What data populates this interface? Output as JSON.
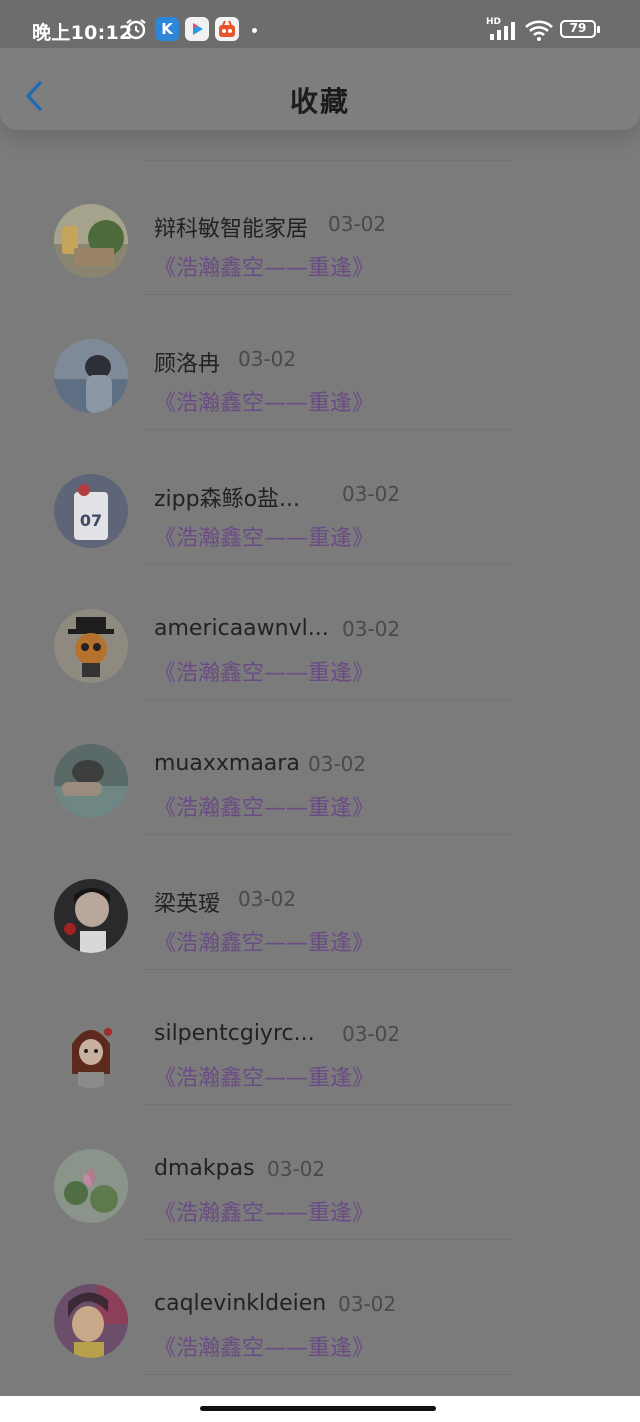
{
  "status_bar": {
    "time": "晚上10:12",
    "battery": "79",
    "network_label": "HD",
    "icons": [
      "alarm-icon",
      "kugou-app-icon",
      "video-app-icon",
      "taobao-app-icon",
      "notification-dot-icon",
      "signal-icon",
      "wifi-icon",
      "battery-icon"
    ]
  },
  "header": {
    "title": "收藏",
    "back_icon": "chevron-left-icon"
  },
  "colors": {
    "accent": "#1e6bb0",
    "work_title": "#6a4c85",
    "overlay_bg": "#7b7b7b"
  },
  "items": [
    {
      "name": "辩科敏智能家居",
      "date": "03-02",
      "work": "《浩瀚鑫空——重逢》",
      "avatar": "avatar-plant-cup"
    },
    {
      "name": "顾洛冉",
      "date": "03-02",
      "work": "《浩瀚鑫空——重逢》",
      "avatar": "avatar-person-sea"
    },
    {
      "name": "zipp森鲧o盐...",
      "date": "03-02",
      "work": "《浩瀚鑫空——重逢》",
      "avatar": "avatar-jersey"
    },
    {
      "name": "americaawnvl...",
      "date": "03-02",
      "work": "《浩瀚鑫空——重逢》",
      "avatar": "avatar-doll-hat"
    },
    {
      "name": "muaxxmaara",
      "date": "03-02",
      "work": "《浩瀚鑫空——重逢》",
      "avatar": "avatar-person-water"
    },
    {
      "name": "梁英瑷",
      "date": "03-02",
      "work": "《浩瀚鑫空——重逢》",
      "avatar": "avatar-person-rose"
    },
    {
      "name": "silpentcgiyrc...",
      "date": "03-02",
      "work": "《浩瀚鑫空——重逢》",
      "avatar": "avatar-cartoon-girl"
    },
    {
      "name": "dmakpas",
      "date": "03-02",
      "work": "《浩瀚鑫空——重逢》",
      "avatar": "avatar-lotus"
    },
    {
      "name": "caqlevinkldeien",
      "date": "03-02",
      "work": "《浩瀚鑫空——重逢》",
      "avatar": "avatar-girl-purple"
    }
  ]
}
